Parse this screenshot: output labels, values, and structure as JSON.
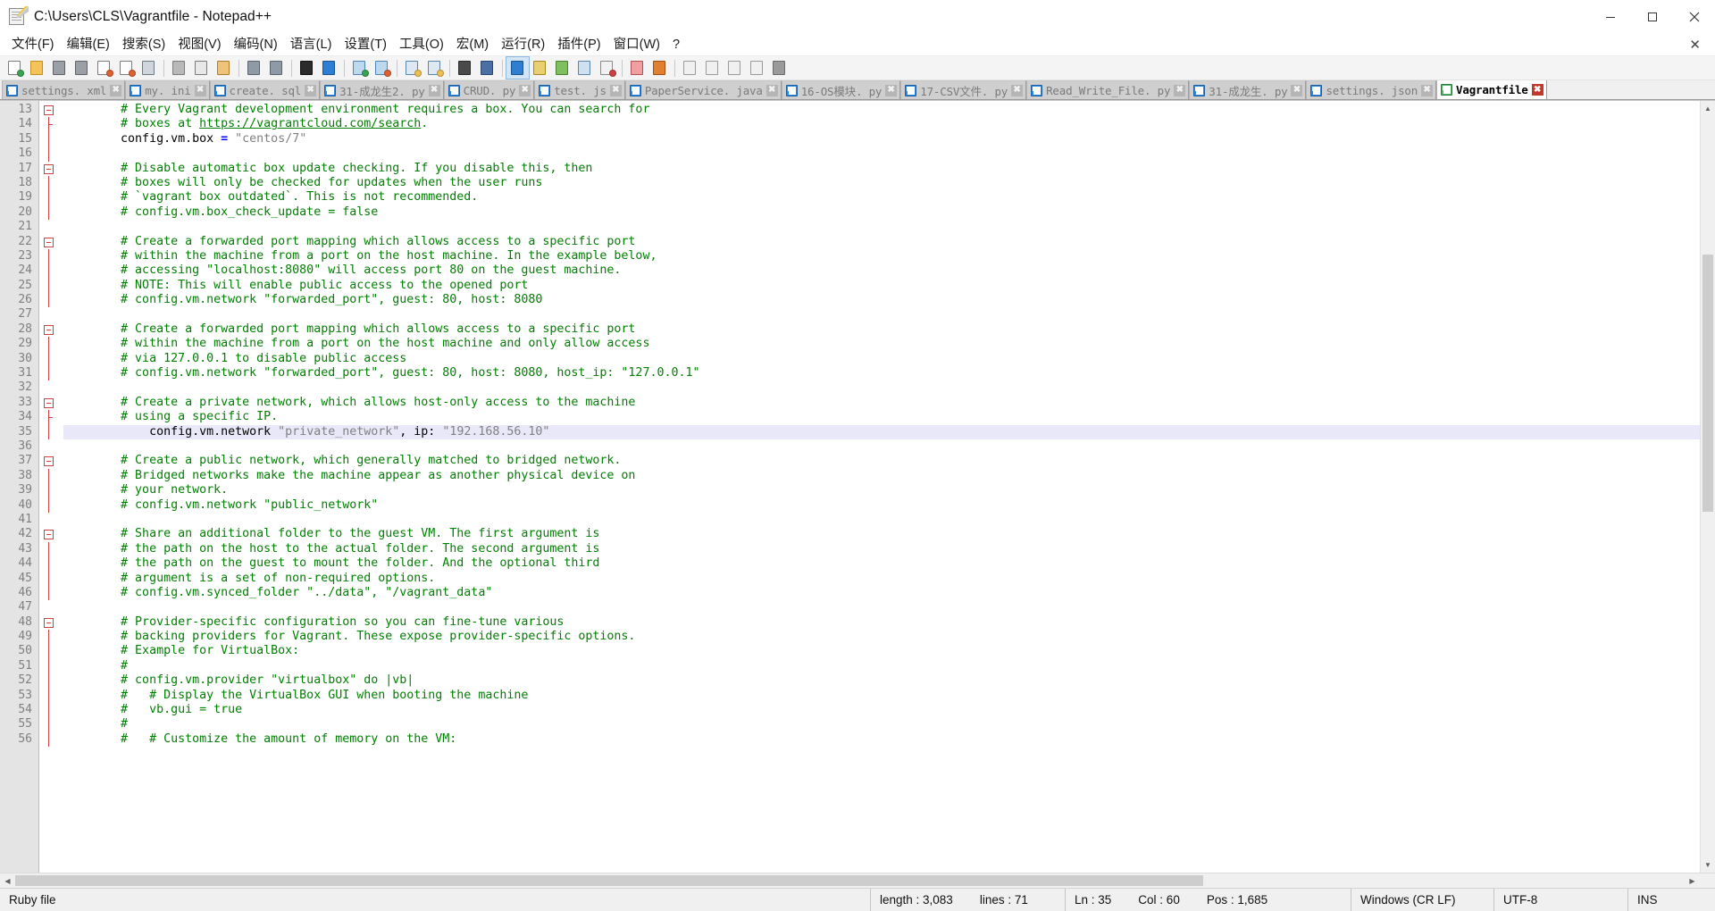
{
  "window": {
    "title": "C:\\Users\\CLS\\Vagrantfile - Notepad++",
    "icon": "notepadpp-icon",
    "minimize_label": "–",
    "maximize_label": "□",
    "close_label": "✕"
  },
  "menubar": {
    "items": [
      {
        "name": "file",
        "label": "文件(F)"
      },
      {
        "name": "edit",
        "label": "编辑(E)"
      },
      {
        "name": "search",
        "label": "搜索(S)"
      },
      {
        "name": "view",
        "label": "视图(V)"
      },
      {
        "name": "encoding",
        "label": "编码(N)"
      },
      {
        "name": "language",
        "label": "语言(L)"
      },
      {
        "name": "settings",
        "label": "设置(T)"
      },
      {
        "name": "tools",
        "label": "工具(O)"
      },
      {
        "name": "macro",
        "label": "宏(M)"
      },
      {
        "name": "run",
        "label": "运行(R)"
      },
      {
        "name": "plugins",
        "label": "插件(P)"
      },
      {
        "name": "window",
        "label": "窗口(W)"
      },
      {
        "name": "help",
        "label": "?"
      }
    ],
    "close_document_label": "✕"
  },
  "toolbar": {
    "buttons": [
      "new-file-icon",
      "open-file-icon",
      "save-icon",
      "save-all-icon",
      "close-file-icon",
      "close-all-icon",
      "print-icon",
      "sep",
      "cut-icon",
      "copy-icon",
      "paste-icon",
      "sep",
      "undo-icon",
      "redo-icon",
      "sep",
      "find-icon",
      "replace-icon",
      "sep",
      "zoom-in-icon",
      "zoom-out-icon",
      "sep",
      "sync-vertical-scroll-icon",
      "sync-horizontal-scroll-icon",
      "sep",
      "word-wrap-icon",
      "show-all-chars-icon",
      "sep",
      "indent-guide-icon",
      "user-defined-dialog-icon",
      "show-doc-map-icon",
      "function-list-icon",
      "document-switcher-icon",
      "sep",
      "folder-as-workspace-icon",
      "monitoring-icon",
      "sep",
      "macro-record-icon",
      "macro-stop-icon",
      "macro-play-icon",
      "macro-save-icon",
      "macro-run-multiple-icon"
    ]
  },
  "tabs": [
    {
      "name": "tab-settings-xml",
      "label": "settings. xml",
      "active": false
    },
    {
      "name": "tab-my-ini",
      "label": "my. ini",
      "active": false
    },
    {
      "name": "tab-create-sql",
      "label": "create. sql",
      "active": false
    },
    {
      "name": "tab-31-chenglongsheng2-py",
      "label": "31-成龙生2. py",
      "active": false
    },
    {
      "name": "tab-crud-py",
      "label": "CRUD. py",
      "active": false
    },
    {
      "name": "tab-test-js",
      "label": "test. js",
      "active": false
    },
    {
      "name": "tab-paperservice-java",
      "label": "PaperService. java",
      "active": false
    },
    {
      "name": "tab-16-os-module-py",
      "label": "16-OS模块. py",
      "active": false
    },
    {
      "name": "tab-17-csv-file-py",
      "label": "17-CSV文件. py",
      "active": false
    },
    {
      "name": "tab-read-write-file-py",
      "label": "Read_Write_File. py",
      "active": false
    },
    {
      "name": "tab-31-chenglongsheng-py",
      "label": "31-成龙生. py",
      "active": false
    },
    {
      "name": "tab-settings-json",
      "label": "settings. json",
      "active": false
    },
    {
      "name": "tab-vagrantfile",
      "label": "Vagrantfile",
      "active": true
    }
  ],
  "tab_close_label": "✖",
  "editor": {
    "first_line_number": 13,
    "highlighted_line": 35,
    "lines": [
      {
        "n": 13,
        "fold": "open",
        "tokens": [
          {
            "t": "# Every Vagrant development environment requires a box. You can search for",
            "c": "cm",
            "indent": 2
          }
        ]
      },
      {
        "n": 14,
        "fold": "tick",
        "tokens": [
          {
            "t": "# boxes at ",
            "c": "cm",
            "indent": 2
          },
          {
            "t": "https://vagrantcloud.com/search",
            "c": "lnk"
          },
          {
            "t": ".",
            "c": "cm"
          }
        ]
      },
      {
        "n": 15,
        "fold": "line",
        "tokens": [
          {
            "t": "config.vm.box ",
            "c": "kw",
            "indent": 2
          },
          {
            "t": "=",
            "c": "op"
          },
          {
            "t": " ",
            "c": "kw"
          },
          {
            "t": "\"centos/7\"",
            "c": "st"
          }
        ]
      },
      {
        "n": 16,
        "fold": "line",
        "tokens": []
      },
      {
        "n": 17,
        "fold": "open",
        "tokens": [
          {
            "t": "# Disable automatic box update checking. If you disable this, then",
            "c": "cm",
            "indent": 2
          }
        ]
      },
      {
        "n": 18,
        "fold": "line",
        "tokens": [
          {
            "t": "# boxes will only be checked for updates when the user runs",
            "c": "cm",
            "indent": 2
          }
        ]
      },
      {
        "n": 19,
        "fold": "line",
        "tokens": [
          {
            "t": "# `vagrant box outdated`. This is not recommended.",
            "c": "cm",
            "indent": 2
          }
        ]
      },
      {
        "n": 20,
        "fold": "line",
        "tokens": [
          {
            "t": "# config.vm.box_check_update = false",
            "c": "cm",
            "indent": 2
          }
        ]
      },
      {
        "n": 21,
        "fold": "none",
        "tokens": []
      },
      {
        "n": 22,
        "fold": "open",
        "tokens": [
          {
            "t": "# Create a forwarded port mapping which allows access to a specific port",
            "c": "cm",
            "indent": 2
          }
        ]
      },
      {
        "n": 23,
        "fold": "line",
        "tokens": [
          {
            "t": "# within the machine from a port on the host machine. In the example below,",
            "c": "cm",
            "indent": 2
          }
        ]
      },
      {
        "n": 24,
        "fold": "line",
        "tokens": [
          {
            "t": "# accessing \"localhost:8080\" will access port 80 on the guest machine.",
            "c": "cm",
            "indent": 2
          }
        ]
      },
      {
        "n": 25,
        "fold": "line",
        "tokens": [
          {
            "t": "# NOTE: This will enable public access to the opened port",
            "c": "cm",
            "indent": 2
          }
        ]
      },
      {
        "n": 26,
        "fold": "line",
        "tokens": [
          {
            "t": "# config.vm.network \"forwarded_port\", guest: 80, host: 8080",
            "c": "cm",
            "indent": 2
          }
        ]
      },
      {
        "n": 27,
        "fold": "none",
        "tokens": []
      },
      {
        "n": 28,
        "fold": "open",
        "tokens": [
          {
            "t": "# Create a forwarded port mapping which allows access to a specific port",
            "c": "cm",
            "indent": 2
          }
        ]
      },
      {
        "n": 29,
        "fold": "line",
        "tokens": [
          {
            "t": "# within the machine from a port on the host machine and only allow access",
            "c": "cm",
            "indent": 2
          }
        ]
      },
      {
        "n": 30,
        "fold": "line",
        "tokens": [
          {
            "t": "# via 127.0.0.1 to disable public access",
            "c": "cm",
            "indent": 2
          }
        ]
      },
      {
        "n": 31,
        "fold": "line",
        "tokens": [
          {
            "t": "# config.vm.network \"forwarded_port\", guest: 80, host: 8080, host_ip: \"127.0.0.1\"",
            "c": "cm",
            "indent": 2
          }
        ]
      },
      {
        "n": 32,
        "fold": "none",
        "tokens": []
      },
      {
        "n": 33,
        "fold": "open",
        "tokens": [
          {
            "t": "# Create a private network, which allows host-only access to the machine",
            "c": "cm",
            "indent": 2
          }
        ]
      },
      {
        "n": 34,
        "fold": "tick",
        "tokens": [
          {
            "t": "# using a specific IP.",
            "c": "cm",
            "indent": 2
          }
        ]
      },
      {
        "n": 35,
        "fold": "line",
        "hl": true,
        "tokens": [
          {
            "t": "config.vm.network ",
            "c": "kw",
            "indent": 3
          },
          {
            "t": "\"private_network\"",
            "c": "st"
          },
          {
            "t": ", ip: ",
            "c": "kw"
          },
          {
            "t": "\"192.168.56.10\"",
            "c": "st"
          }
        ]
      },
      {
        "n": 36,
        "fold": "none",
        "tokens": []
      },
      {
        "n": 37,
        "fold": "open",
        "tokens": [
          {
            "t": "# Create a public network, which generally matched to bridged network.",
            "c": "cm",
            "indent": 2
          }
        ]
      },
      {
        "n": 38,
        "fold": "line",
        "tokens": [
          {
            "t": "# Bridged networks make the machine appear as another physical device on",
            "c": "cm",
            "indent": 2
          }
        ]
      },
      {
        "n": 39,
        "fold": "line",
        "tokens": [
          {
            "t": "# your network.",
            "c": "cm",
            "indent": 2
          }
        ]
      },
      {
        "n": 40,
        "fold": "line",
        "tokens": [
          {
            "t": "# config.vm.network \"public_network\"",
            "c": "cm",
            "indent": 2
          }
        ]
      },
      {
        "n": 41,
        "fold": "none",
        "tokens": []
      },
      {
        "n": 42,
        "fold": "open",
        "tokens": [
          {
            "t": "# Share an additional folder to the guest VM. The first argument is",
            "c": "cm",
            "indent": 2
          }
        ]
      },
      {
        "n": 43,
        "fold": "line",
        "tokens": [
          {
            "t": "# the path on the host to the actual folder. The second argument is",
            "c": "cm",
            "indent": 2
          }
        ]
      },
      {
        "n": 44,
        "fold": "line",
        "tokens": [
          {
            "t": "# the path on the guest to mount the folder. And the optional third",
            "c": "cm",
            "indent": 2
          }
        ]
      },
      {
        "n": 45,
        "fold": "line",
        "tokens": [
          {
            "t": "# argument is a set of non-required options.",
            "c": "cm",
            "indent": 2
          }
        ]
      },
      {
        "n": 46,
        "fold": "line",
        "tokens": [
          {
            "t": "# config.vm.synced_folder \"../data\", \"/vagrant_data\"",
            "c": "cm",
            "indent": 2
          }
        ]
      },
      {
        "n": 47,
        "fold": "none",
        "tokens": []
      },
      {
        "n": 48,
        "fold": "open",
        "tokens": [
          {
            "t": "# Provider-specific configuration so you can fine-tune various",
            "c": "cm",
            "indent": 2
          }
        ]
      },
      {
        "n": 49,
        "fold": "line",
        "tokens": [
          {
            "t": "# backing providers for Vagrant. These expose provider-specific options.",
            "c": "cm",
            "indent": 2
          }
        ]
      },
      {
        "n": 50,
        "fold": "line",
        "tokens": [
          {
            "t": "# Example for VirtualBox:",
            "c": "cm",
            "indent": 2
          }
        ]
      },
      {
        "n": 51,
        "fold": "line",
        "tokens": [
          {
            "t": "#",
            "c": "cm",
            "indent": 2
          }
        ]
      },
      {
        "n": 52,
        "fold": "line",
        "tokens": [
          {
            "t": "# config.vm.provider \"virtualbox\" do |vb|",
            "c": "cm",
            "indent": 2
          }
        ]
      },
      {
        "n": 53,
        "fold": "line",
        "tokens": [
          {
            "t": "#   # Display the VirtualBox GUI when booting the machine",
            "c": "cm",
            "indent": 2
          }
        ]
      },
      {
        "n": 54,
        "fold": "line",
        "tokens": [
          {
            "t": "#   vb.gui = true",
            "c": "cm",
            "indent": 2
          }
        ]
      },
      {
        "n": 55,
        "fold": "line",
        "tokens": [
          {
            "t": "#",
            "c": "cm",
            "indent": 2
          }
        ]
      },
      {
        "n": 56,
        "fold": "line",
        "tokens": [
          {
            "t": "#   # Customize the amount of memory on the VM:",
            "c": "cm",
            "indent": 2
          }
        ]
      }
    ]
  },
  "statusbar": {
    "file_type": "Ruby file",
    "length_label": "length : 3,083",
    "lines_label": "lines : 71",
    "ln_label": "Ln : 35",
    "col_label": "Col : 60",
    "pos_label": "Pos : 1,685",
    "eol": "Windows (CR LF)",
    "encoding": "UTF-8",
    "insert_mode": "INS"
  },
  "colors": {
    "comment_green": "#008000",
    "string_grey": "#808080",
    "operator_blue": "#0000ff",
    "fold_red": "#d04040",
    "tab_active_bg": "#fdfdfd",
    "tab_inactive_bg": "#cfcfcf",
    "highlight_line": "#e8e8f8"
  }
}
